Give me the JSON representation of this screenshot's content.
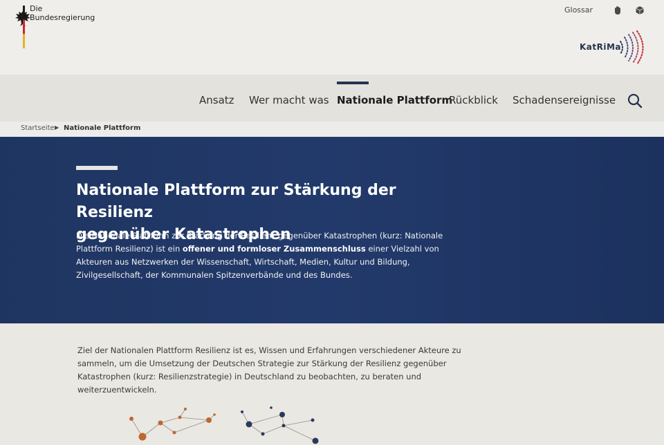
{
  "header": {
    "logo_line1": "Die",
    "logo_line2": "Bundesregierung",
    "glossar": "Glossar",
    "katrima": "KatRiMa",
    "icons": [
      "eagle-icon",
      "sign-language-icon",
      "accessibility-cube-icon"
    ]
  },
  "nav": {
    "items": [
      {
        "label": "Ansatz"
      },
      {
        "label": "Wer macht was"
      },
      {
        "label": "Nationale Plattform"
      },
      {
        "label": "Rückblick"
      },
      {
        "label": "Schadensereignisse"
      }
    ],
    "active": "Nationale Plattform",
    "search_icon": "search-icon"
  },
  "breadcrumb": {
    "home": "Startseite",
    "current": "Nationale Plattform"
  },
  "hero": {
    "title_line1": "Nationale Plattform zur Stärkung der Resilienz",
    "title_line2": "gegenüber Katastrophen",
    "text_part1": "Die Nationale Plattform zur Stärkung der Resilienz gegenüber Katastrophen (kurz: Nationale Plattform Resilienz) ist ein ",
    "text_bold": "offener und formloser Zusammenschluss",
    "text_part2": " einer Vielzahl von Akteuren aus Netzwerken der Wissenschaft, Wirtschaft, Medien, Kultur und Bildung, Zivilgesellschaft, der Kommunalen Spitzenverbände und des Bundes."
  },
  "intro": {
    "text": "Ziel der Nationalen Plattform Resilienz ist es, Wissen und Erfahrungen verschiedener Akteure zu sammeln, um die Umsetzung der Deutschen Strategie zur Stärkung der Resilienz gegenüber Katastrophen (kurz: Resilienzstrategie) in Deutschland zu beobachten, zu beraten und weiterzuentwickeln."
  },
  "colors": {
    "hero_bg": "#223a6b",
    "brand_dark": "#26324f",
    "network_orange": "#c0662e",
    "network_navy": "#2a3a5c"
  }
}
